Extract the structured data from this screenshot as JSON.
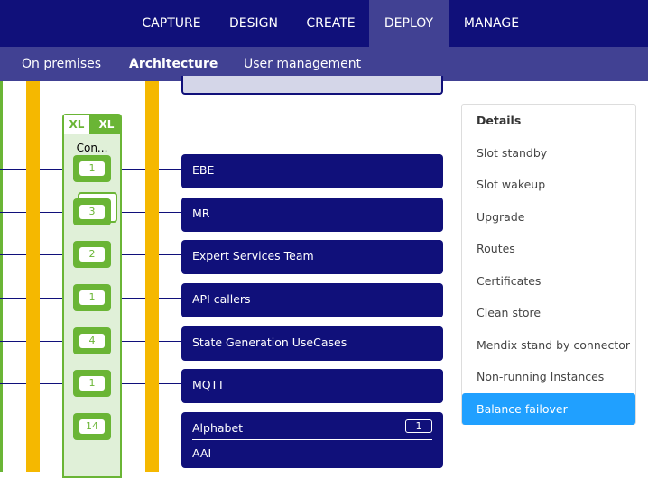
{
  "topnav": {
    "items": [
      "CAPTURE",
      "DESIGN",
      "CREATE",
      "DEPLOY",
      "MANAGE"
    ],
    "active": "DEPLOY"
  },
  "subnav": {
    "items": [
      "On premises",
      "Architecture",
      "User management"
    ],
    "active": "Architecture"
  },
  "column": {
    "size_left": "XL",
    "size_right": "XL",
    "title": "Con..."
  },
  "rows": [
    {
      "badge": "1",
      "label": "EBE"
    },
    {
      "badge": "3",
      "label": "MR"
    },
    {
      "badge": "2",
      "label": "Expert Services Team"
    },
    {
      "badge": "1",
      "label": "API callers"
    },
    {
      "badge": "4",
      "label": "State Generation UseCases"
    },
    {
      "badge": "1",
      "label": "MQTT"
    },
    {
      "badge": "14",
      "label": "Alphabet",
      "count": "1",
      "sublabel": "AAI"
    }
  ],
  "menu": {
    "header": "Details",
    "items": [
      "Slot standby",
      "Slot wakeup",
      "Upgrade",
      "Routes",
      "Certificates",
      "Clean store",
      "Mendix stand by connector",
      "Non-running Instances",
      "Balance failover"
    ],
    "selected": "Balance failover"
  },
  "colors": {
    "navy": "#10107a",
    "purple": "#414193",
    "green": "#6ab535",
    "yellow": "#f5b800",
    "blue": "#20a0ff"
  }
}
